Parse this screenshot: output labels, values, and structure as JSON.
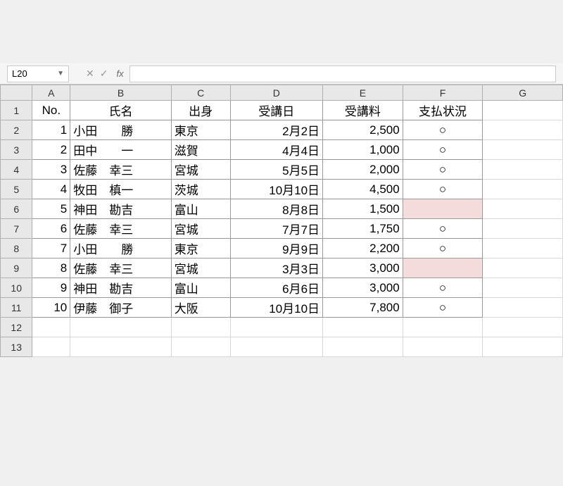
{
  "nameBox": "L20",
  "fxLabel": "fx",
  "columns": [
    "A",
    "B",
    "C",
    "D",
    "E",
    "F",
    "G"
  ],
  "headers": {
    "no": "No.",
    "name": "氏名",
    "origin": "出身",
    "date": "受講日",
    "fee": "受講料",
    "status": "支払状況"
  },
  "rows": [
    {
      "no": "1",
      "name": "小田　　勝",
      "origin": "東京",
      "date": "2月2日",
      "fee": "2,500",
      "status": "○",
      "hl": false
    },
    {
      "no": "2",
      "name": "田中　　一",
      "origin": "滋賀",
      "date": "4月4日",
      "fee": "1,000",
      "status": "○",
      "hl": false
    },
    {
      "no": "3",
      "name": "佐藤　幸三",
      "origin": "宮城",
      "date": "5月5日",
      "fee": "2,000",
      "status": "○",
      "hl": false
    },
    {
      "no": "4",
      "name": "牧田　槙一",
      "origin": "茨城",
      "date": "10月10日",
      "fee": "4,500",
      "status": "○",
      "hl": false
    },
    {
      "no": "5",
      "name": "神田　勘吉",
      "origin": "富山",
      "date": "8月8日",
      "fee": "1,500",
      "status": "",
      "hl": true
    },
    {
      "no": "6",
      "name": "佐藤　幸三",
      "origin": "宮城",
      "date": "7月7日",
      "fee": "1,750",
      "status": "○",
      "hl": false
    },
    {
      "no": "7",
      "name": "小田　　勝",
      "origin": "東京",
      "date": "9月9日",
      "fee": "2,200",
      "status": "○",
      "hl": false
    },
    {
      "no": "8",
      "name": "佐藤　幸三",
      "origin": "宮城",
      "date": "3月3日",
      "fee": "3,000",
      "status": "",
      "hl": true
    },
    {
      "no": "9",
      "name": "神田　勘吉",
      "origin": "富山",
      "date": "6月6日",
      "fee": "3,000",
      "status": "○",
      "hl": false
    },
    {
      "no": "10",
      "name": "伊藤　御子",
      "origin": "大阪",
      "date": "10月10日",
      "fee": "7,800",
      "status": "○",
      "hl": false
    }
  ],
  "emptyRows": [
    12,
    13
  ]
}
